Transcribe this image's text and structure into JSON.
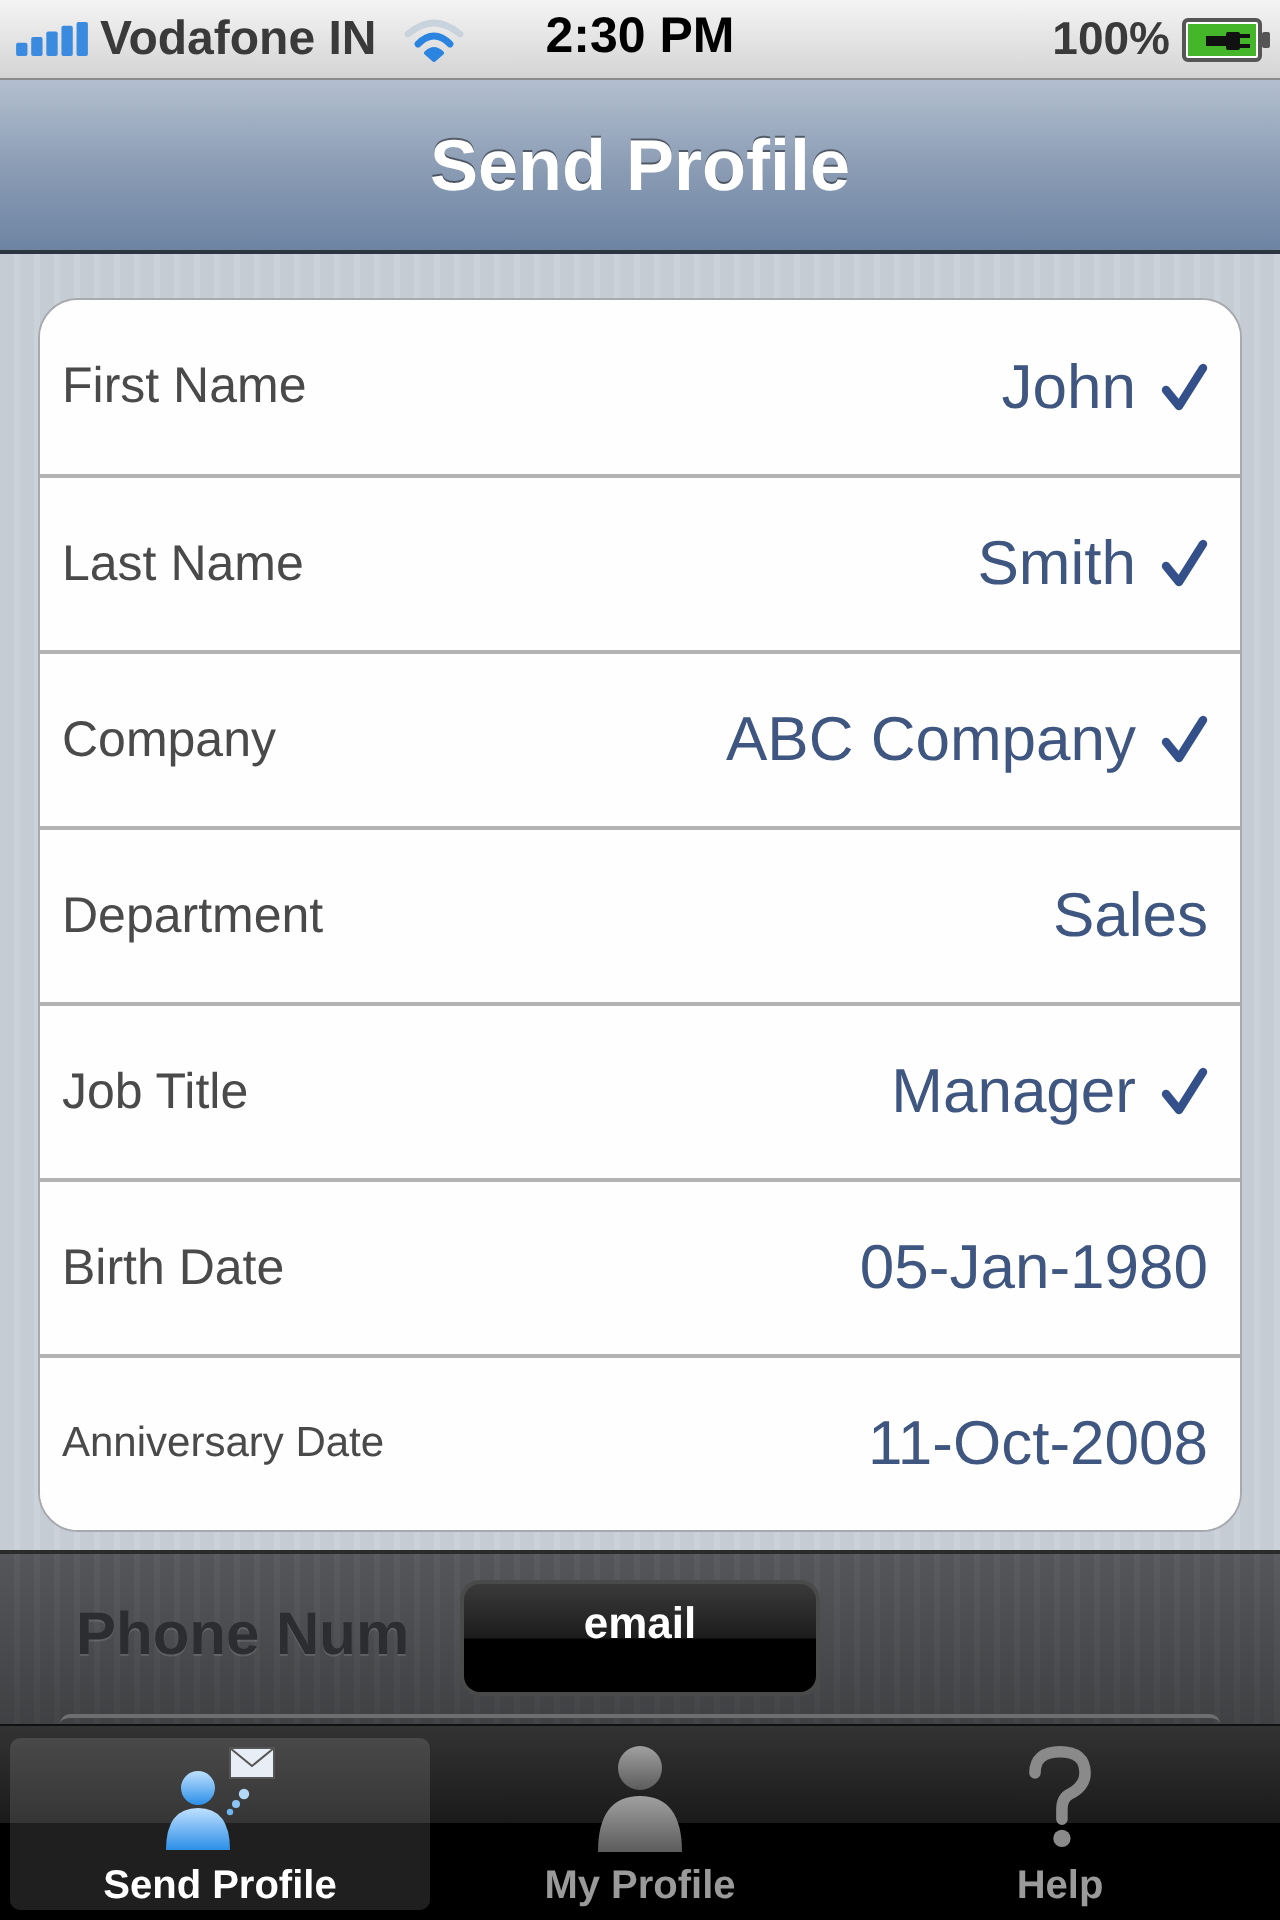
{
  "status_bar": {
    "carrier": "Vodafone IN",
    "time": "2:30 PM",
    "battery": "100%"
  },
  "nav_bar": {
    "title": "Send Profile"
  },
  "fields": [
    {
      "label": "First Name",
      "value": "John",
      "checked": true
    },
    {
      "label": "Last Name",
      "value": "Smith",
      "checked": true
    },
    {
      "label": "Company",
      "value": "ABC Company",
      "checked": true
    },
    {
      "label": "Department",
      "value": "Sales",
      "checked": false
    },
    {
      "label": "Job Title",
      "value": "Manager",
      "checked": true
    },
    {
      "label": "Birth Date",
      "value": "05-Jan-1980",
      "checked": false
    },
    {
      "label": "Anniversary Date",
      "value": "11-Oct-2008",
      "checked": false
    }
  ],
  "dimmed_section": {
    "label": "Phone Num"
  },
  "popup_button": {
    "label": "email"
  },
  "tab_bar": {
    "tabs": [
      {
        "label": "Send Profile",
        "selected": true
      },
      {
        "label": "My Profile",
        "selected": false
      },
      {
        "label": "Help",
        "selected": false
      }
    ]
  }
}
